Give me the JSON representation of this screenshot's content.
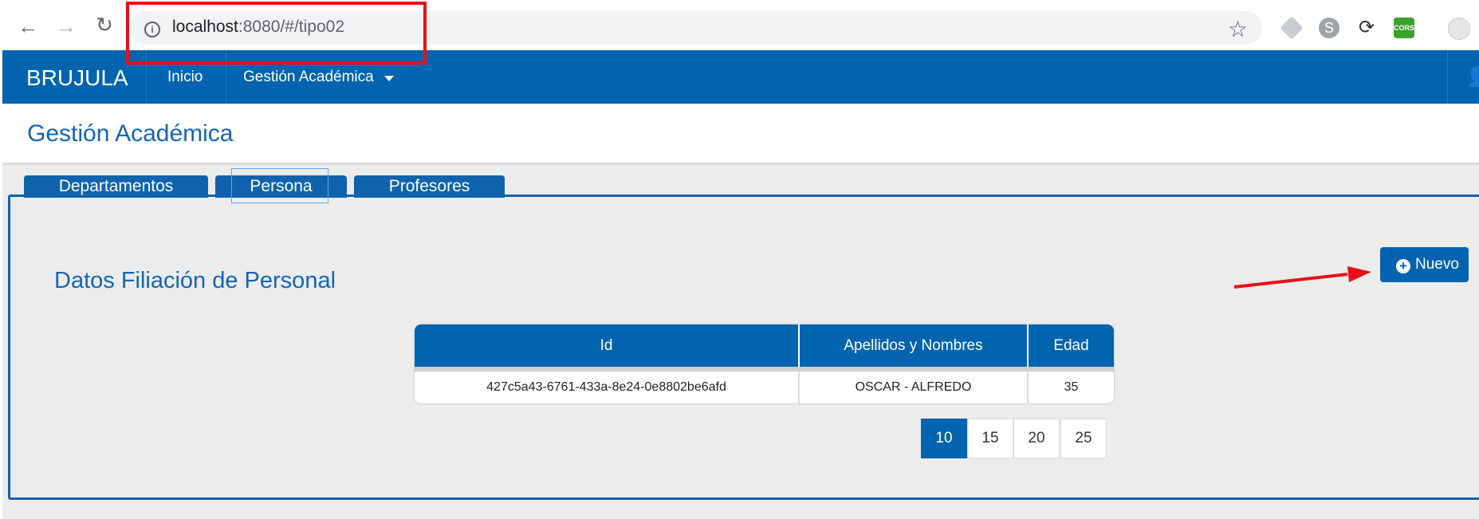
{
  "browser": {
    "url_host": "localhost",
    "url_rest": ":8080/#/tipo02",
    "back_icon": "arrow-left-icon",
    "forward_icon": "arrow-right-icon",
    "reload_icon": "reload-icon",
    "bookmark_icon": "star-icon",
    "extensions": [
      "cube-extension-icon",
      "skype-extension-icon",
      "sync-extension-icon",
      "cors-extension-icon",
      "avatar-icon"
    ],
    "cors_label": "CORS"
  },
  "navbar": {
    "brand": "BRUJULA",
    "items": [
      {
        "label": "Inicio"
      },
      {
        "label": "Gestión Académica",
        "has_dropdown": true
      }
    ],
    "color": "#0264ae"
  },
  "page": {
    "title": "Gestión Académica"
  },
  "tabs": [
    {
      "label": "Departamentos",
      "active": false
    },
    {
      "label": "Persona",
      "active": true
    },
    {
      "label": "Profesores",
      "active": false
    }
  ],
  "section": {
    "title": "Datos Filiación de Personal",
    "new_button_label": "Nuevo"
  },
  "table": {
    "headers": [
      "Id",
      "Apellidos y Nombres",
      "Edad"
    ],
    "rows": [
      [
        "427c5a43-6761-433a-8e24-0e8802be6afd",
        "OSCAR - ALFREDO",
        "35"
      ]
    ]
  },
  "pagination": {
    "options": [
      "10",
      "15",
      "20",
      "25"
    ],
    "selected": "10"
  },
  "annotations": {
    "highlight_color": "#e8101a"
  }
}
